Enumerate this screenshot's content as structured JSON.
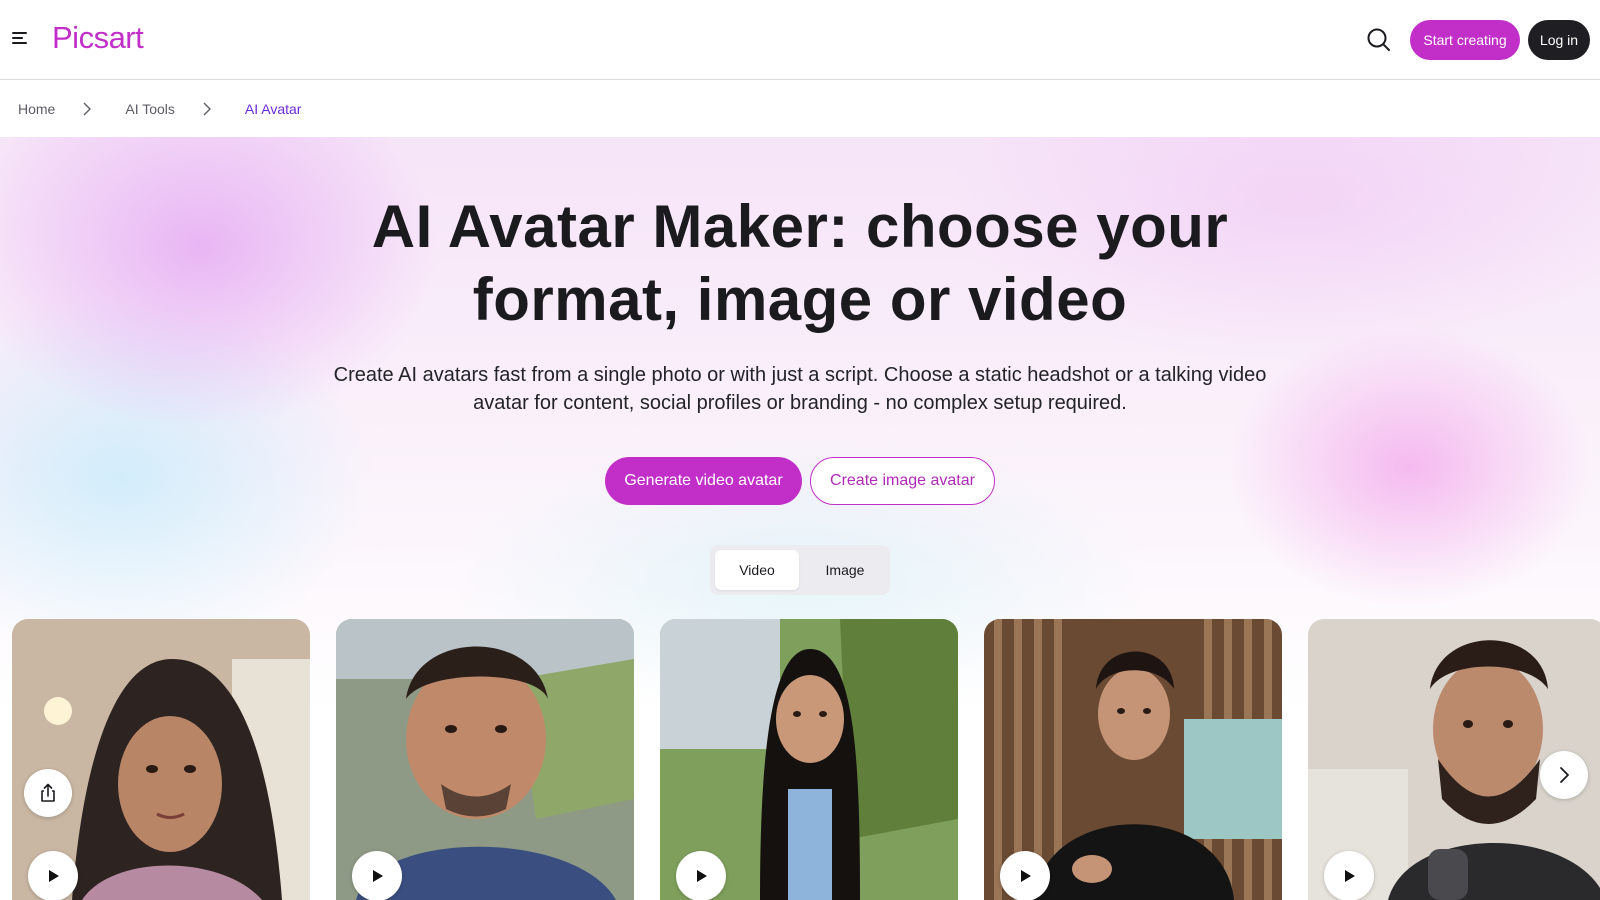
{
  "header": {
    "logo": "Picsart",
    "start_label": "Start creating",
    "login_label": "Log in"
  },
  "breadcrumb": {
    "items": [
      "Home",
      "AI Tools",
      "AI Avatar"
    ]
  },
  "hero": {
    "title_line1": "AI Avatar Maker: choose your",
    "title_line2": "format, image or video",
    "subtitle_line1": "Create AI avatars fast from a single photo or with just a script. Choose a static headshot or a talking video",
    "subtitle_line2": "avatar for content, social profiles or branding - no complex setup required.",
    "primary_cta": "Generate video avatar",
    "secondary_cta": "Create image avatar"
  },
  "toggle": {
    "options": [
      "Video",
      "Image"
    ],
    "selected": "Video"
  },
  "colors": {
    "brand": "#c22fc8",
    "dark": "#1f1f23",
    "active_crumb": "#6c2bd9"
  },
  "icons": {
    "menu": "menu-icon",
    "search": "search-icon",
    "chevron": "chevron-right-icon",
    "play": "play-icon",
    "share": "share-icon",
    "next": "next-arrow-icon"
  }
}
